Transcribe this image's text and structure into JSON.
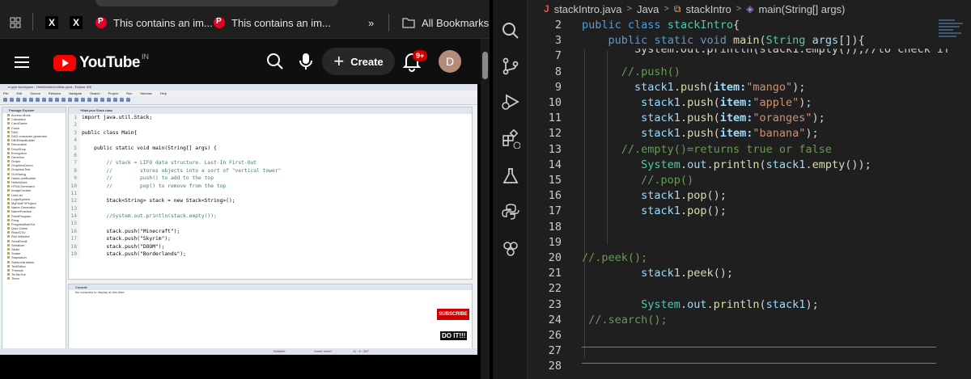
{
  "bookmarks": {
    "items": [
      {
        "label": "",
        "icon": "x-logo"
      },
      {
        "label": "",
        "icon": "x-logo"
      },
      {
        "label": "This contains an im...",
        "icon": "pinterest-icon"
      },
      {
        "label": "This contains an im...",
        "icon": "pinterest-icon"
      }
    ],
    "overflow": "»",
    "all_bookmarks": "All Bookmarks"
  },
  "youtube": {
    "logo_text": "YouTube",
    "region": "IN",
    "create_label": "Create",
    "notif_count": "9+",
    "avatar_letter": "D"
  },
  "eclipse": {
    "title": "e-type workspace - HelloWorld/src/Main.java - Eclipse IDE",
    "menu": [
      "File",
      "Edit",
      "Source",
      "Refactor",
      "Navigate",
      "Search",
      "Project",
      "Run",
      "Window",
      "Help"
    ],
    "package_explorer": "Package Explorer",
    "projects": [
      "Access Mods",
      "Calculator",
      "CardGame",
      "Clock",
      "D&D",
      "D&D character generator",
      "DB/EMaxBuilder",
      "Decorative",
      "DropShop",
      "Encryption",
      "Generics",
      "Graph",
      "GraphicsDemo",
      "GraphicsTest",
      "GUISwing",
      "HashLoveBuilder",
      "HelloWorld",
      "HTMLGenerator",
      "ImageCreator",
      "LinkList",
      "LoginSystem",
      "MyFirstFXProject",
      "Name Generator",
      "NamePractice",
      "PaintProgram",
      "Pong",
      "ProgressBarGUI",
      "Quiz Game",
      "ReadCSV",
      "Roll Initiative",
      "SendEmail",
      "Serializer",
      "Slider",
      "Snake",
      "Stopwatch",
      "SwitchVariables",
      "TextEditor",
      "Threads",
      "TicTacToe",
      "Timer"
    ],
    "tabs": "*Main.java    Stack.class",
    "lines": [
      {
        "n": "1",
        "t": "import java.util.Stack;"
      },
      {
        "n": "2",
        "t": ""
      },
      {
        "n": "3",
        "t": "public class Main{"
      },
      {
        "n": "4",
        "t": ""
      },
      {
        "n": "5",
        "t": "    public static void main(String[] args) {"
      },
      {
        "n": "6",
        "t": ""
      },
      {
        "n": "7",
        "t": "        // stack = LIFO data structure. Last-In First-Out"
      },
      {
        "n": "8",
        "t": "        //         stores objects into a sort of \"vertical tower\""
      },
      {
        "n": "9",
        "t": "        //         push() to add to the top"
      },
      {
        "n": "10",
        "t": "        //         pop() to remove from the top"
      },
      {
        "n": "11",
        "t": ""
      },
      {
        "n": "12",
        "t": "        Stack<String> stack = new Stack<String>();"
      },
      {
        "n": "13",
        "t": ""
      },
      {
        "n": "14",
        "t": "        //System.out.println(stack.empty());"
      },
      {
        "n": "15",
        "t": ""
      },
      {
        "n": "16",
        "t": "        stack.push(\"Minecraft\");"
      },
      {
        "n": "17",
        "t": "        stack.push(\"Skyrim\");"
      },
      {
        "n": "18",
        "t": "        stack.push(\"DOOM\");"
      },
      {
        "n": "19",
        "t": "        stack.push(\"Borderlands\");"
      }
    ],
    "console_title": "Console",
    "console_text": "No consoles to display at this time.",
    "status": [
      "Writable",
      "Smart Insert",
      "11 : 6 : 287"
    ],
    "subscribe": "SUBSCRIBE",
    "doit": "DO IT!!!"
  },
  "breadcrumb": {
    "file": "stackIntro.java",
    "folder": "Java",
    "class": "stackIntro",
    "method": "main(String[] args)"
  },
  "code_lines": [
    {
      "n": "2",
      "html": "<span class='kw'>public</span> <span class='kw'>class</span> <span class='cls'>stackIntro</span>{",
      "indent": 0
    },
    {
      "n": "3",
      "html": "    <span class='kw'>public</span> <span class='kw'>static</span> <span class='kw'>void</span> <span class='fn'>main</span>(<span class='cls'>String</span> <span class='vr'>args</span>[]){",
      "indent": 0
    },
    {
      "n": "7",
      "html": "        System.out.println(stack1.empty());//to check if",
      "indent": 0
    },
    {
      "n": "8",
      "html": "      <span class='cm'>//.push()</span>",
      "indent": 0
    },
    {
      "n": "9",
      "html": "        <span class='vr'>stack1</span>.<span class='fn'>push</span>(<span class='ph'>item:</span><span class='str'>\"mango\"</span>);",
      "indent": 0
    },
    {
      "n": "10",
      "html": "         <span class='vr'>stack1</span>.<span class='fn'>push</span>(<span class='ph'>item:</span><span class='str'>\"apple\"</span>);",
      "indent": 0
    },
    {
      "n": "11",
      "html": "         <span class='vr'>stack1</span>.<span class='fn'>push</span>(<span class='ph'>item:</span><span class='str'>\"oranges\"</span>);",
      "indent": 0
    },
    {
      "n": "12",
      "html": "         <span class='vr'>stack1</span>.<span class='fn'>push</span>(<span class='ph'>item:</span><span class='str'>\"banana\"</span>);",
      "indent": 0
    },
    {
      "n": "13",
      "html": "      <span class='cm'>//.empty()=returns true or false</span>",
      "indent": 0
    },
    {
      "n": "14",
      "html": "         <span class='cls'>System</span>.<span class='vr'>out</span>.<span class='fn'>println</span>(<span class='vr'>stack1</span>.<span class='fn'>empty</span>());",
      "indent": 0
    },
    {
      "n": "15",
      "html": "         <span class='cm'>//.pop()</span>",
      "indent": 0
    },
    {
      "n": "16",
      "html": "         <span class='vr'>stack1</span>.<span class='fn'>pop</span>();",
      "indent": 0
    },
    {
      "n": "17",
      "html": "         <span class='vr'>stack1</span>.<span class='fn'>pop</span>();",
      "indent": 0
    },
    {
      "n": "18",
      "html": "",
      "indent": 0
    },
    {
      "n": "19",
      "html": "",
      "indent": 0
    },
    {
      "n": "20",
      "html": "<span class='cm'>//.peek();</span>",
      "indent": 0
    },
    {
      "n": "21",
      "html": "         <span class='vr'>stack1</span>.<span class='fn'>peek</span>();",
      "indent": 0
    },
    {
      "n": "22",
      "html": "",
      "indent": 0
    },
    {
      "n": "23",
      "html": "         <span class='cls'>System</span>.<span class='vr'>out</span>.<span class='fn'>println</span>(<span class='vr'>stack1</span>);",
      "indent": 0
    },
    {
      "n": "24",
      "html": " <span class='cm'>//.search();</span>",
      "indent": 0
    },
    {
      "n": "26",
      "html": "",
      "indent": 0
    },
    {
      "n": "27",
      "html": "",
      "indent": 0
    },
    {
      "n": "28",
      "html": "",
      "indent": 0
    }
  ],
  "colors": {
    "youtube_red": "#ff0000",
    "ide_bg": "#1f1f1f",
    "keyword": "#569cd6",
    "type": "#4ec9b0",
    "function": "#dcdcaa",
    "variable": "#9cdcfe",
    "string": "#ce9178",
    "comment": "#6a9955",
    "current_line_border": "#bb6a28"
  }
}
